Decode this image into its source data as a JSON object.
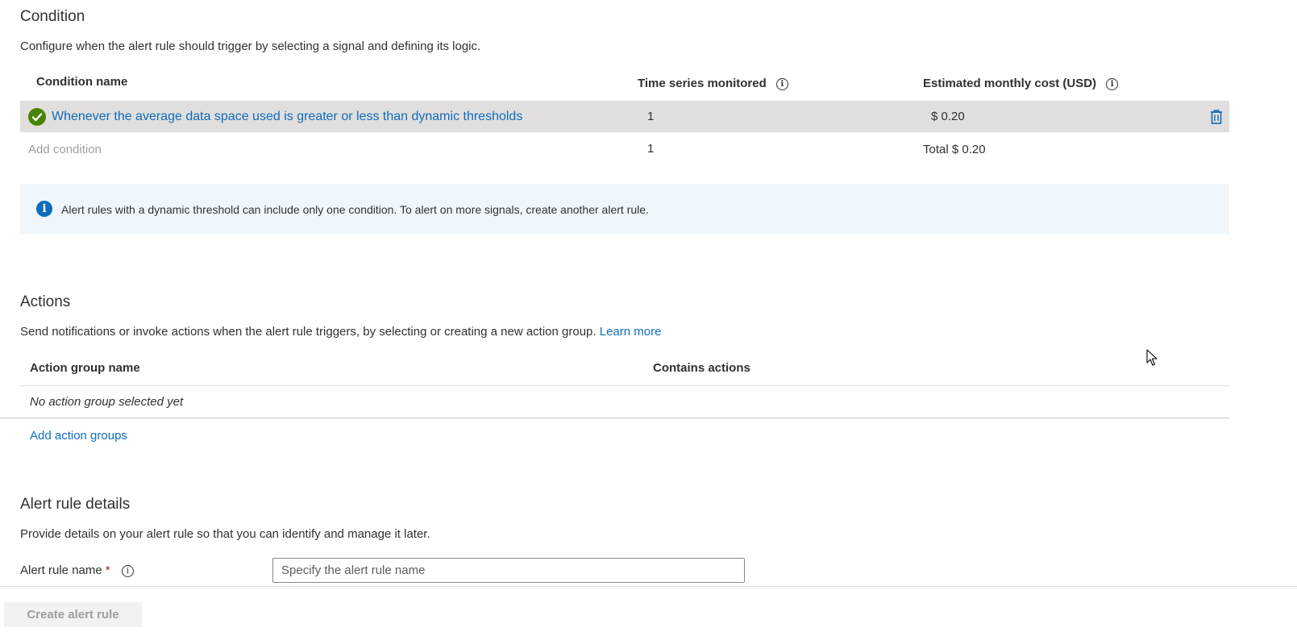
{
  "condition": {
    "title": "Condition",
    "description": "Configure when the alert rule should trigger by selecting a signal and defining its logic.",
    "headers": {
      "name": "Condition name",
      "time_series": "Time series monitored",
      "cost": "Estimated monthly cost (USD)"
    },
    "row": {
      "name": "Whenever the average data space used is greater or less than dynamic thresholds",
      "time_series": "1",
      "cost": "$ 0.20"
    },
    "add_row": {
      "label": "Add condition",
      "time_series": "1",
      "total": "Total $ 0.20"
    },
    "info_message": "Alert rules with a dynamic threshold can include only one condition. To alert on more signals, create another alert rule."
  },
  "actions": {
    "title": "Actions",
    "description": "Send notifications or invoke actions when the alert rule triggers, by selecting or creating a new action group.",
    "learn_more": "Learn more",
    "headers": {
      "group_name": "Action group name",
      "contains": "Contains actions"
    },
    "empty_text": "No action group selected yet",
    "add_link": "Add action groups"
  },
  "details": {
    "title": "Alert rule details",
    "description": "Provide details on your alert rule so that you can identify and manage it later.",
    "name_label": "Alert rule name",
    "required_mark": "*",
    "name_placeholder": "Specify the alert rule name"
  },
  "footer": {
    "create_label": "Create alert rule"
  },
  "colors": {
    "link": "#0f6cbd",
    "success": "#498205",
    "required": "#a4262c",
    "row_selected": "#e1dfdd",
    "info_bg": "#eff6fc"
  },
  "icons": {
    "check": "check-circle-icon",
    "delete": "trash-icon",
    "info": "info-icon",
    "cursor": "mouse-pointer-icon"
  }
}
